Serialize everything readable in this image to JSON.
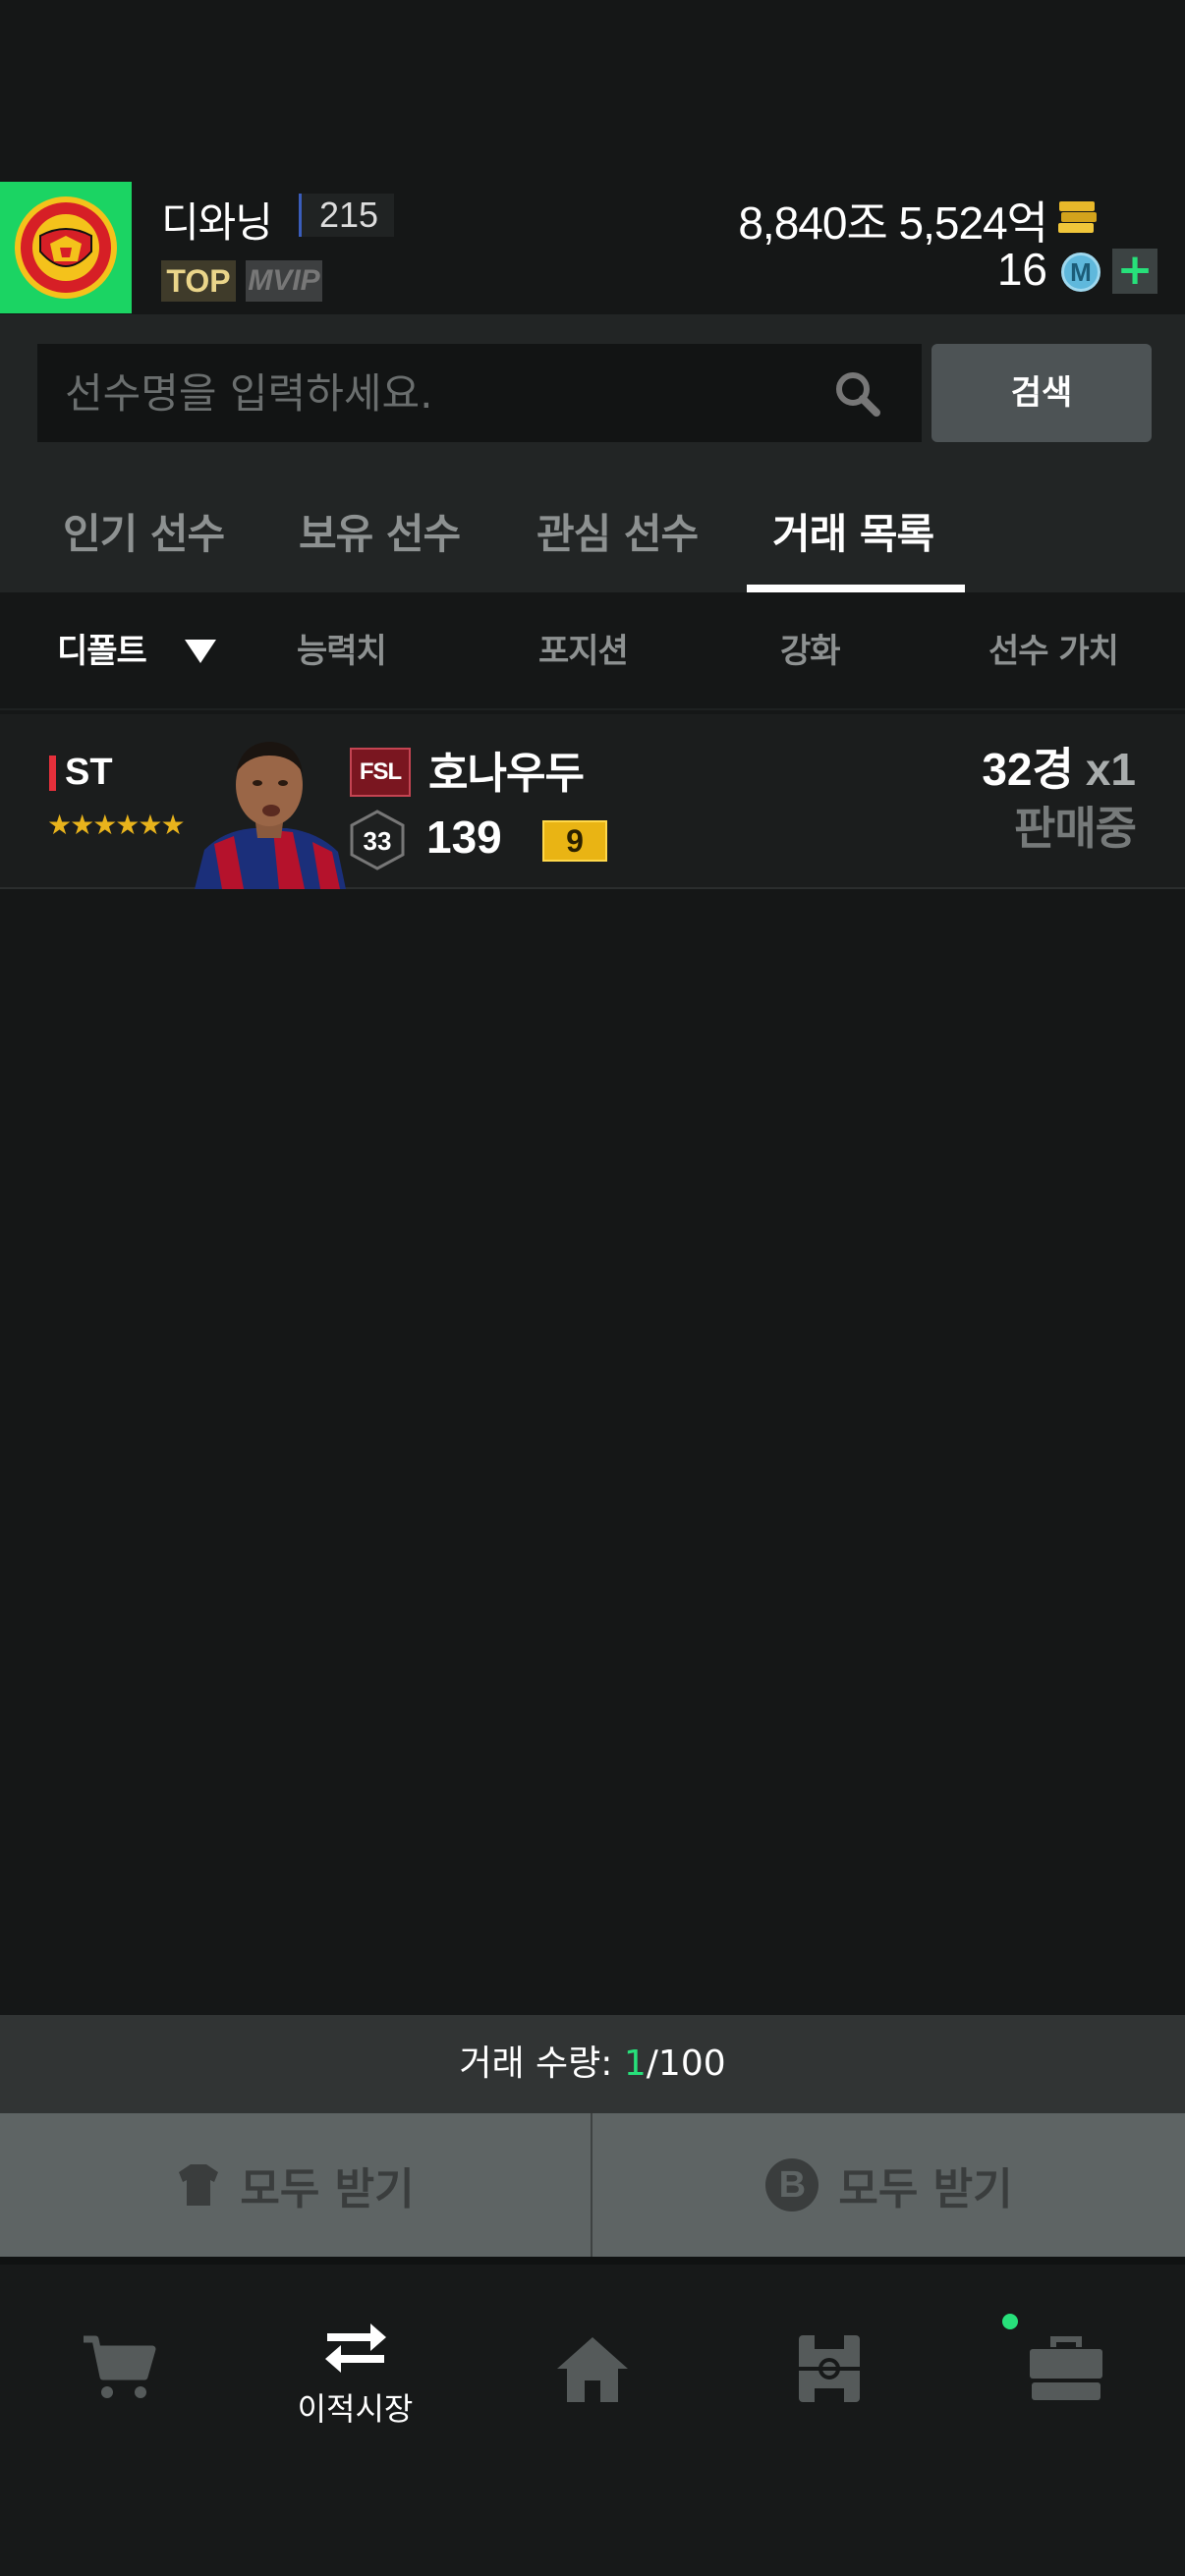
{
  "profile": {
    "nickname": "디와닝",
    "level": "215",
    "badge_top": "TOP",
    "badge_vip": "VIP",
    "currency": "8,840조 5,524억",
    "mpoints": "16",
    "mpoint_symbol": "M",
    "add_symbol": "+"
  },
  "search": {
    "placeholder": "선수명을 입력하세요.",
    "button_label": "검색"
  },
  "tabs": [
    {
      "label": "인기 선수",
      "active": false
    },
    {
      "label": "보유 선수",
      "active": false
    },
    {
      "label": "관심 선수",
      "active": false
    },
    {
      "label": "거래 목록",
      "active": true
    }
  ],
  "sort": {
    "default_label": "디폴트",
    "columns": [
      "능력치",
      "포지션",
      "강화",
      "선수 가치"
    ]
  },
  "player": {
    "position": "ST",
    "stars": "★★★★★★",
    "season": "FSL",
    "name": "호나우두",
    "salary": "33",
    "ovr": "139",
    "grade": "9",
    "price": "32경",
    "quantity": "x1",
    "status": "판매중"
  },
  "trade_count": {
    "label": "거래 수량: ",
    "current": "1",
    "max": "/100"
  },
  "receive": {
    "left_label": "모두 받기",
    "right_label": "모두 받기",
    "b_symbol": "B"
  },
  "nav": {
    "shop_icon": "cart-icon",
    "transfer_label": "이적시장",
    "home_icon": "home-icon",
    "squad_icon": "pitch-icon",
    "locker_icon": "briefcase-icon"
  },
  "colors": {
    "accent_green": "#27e07a",
    "club_green": "#1bd463",
    "gold": "#e9b414",
    "sell_red": "#e5303b"
  }
}
